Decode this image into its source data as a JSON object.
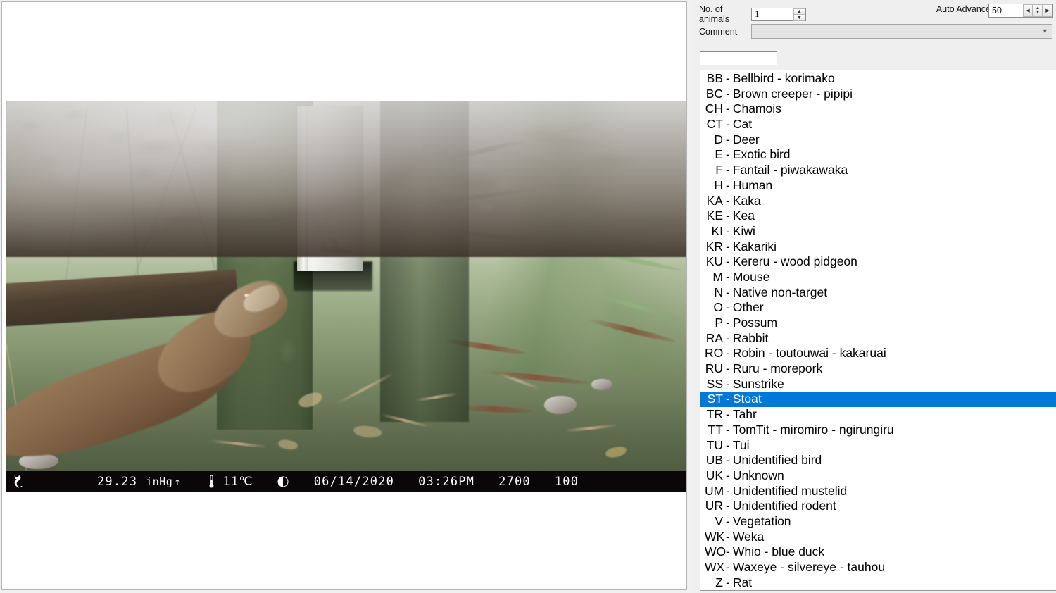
{
  "viewer": {
    "photo": {
      "alt_description": "camera-trap photo of a stoat beside a white metal trap box on a mossy tree trunk in New Zealand bush",
      "infobar": {
        "logo_icon": "browning-buck-logo-icon",
        "pressure": "29.23",
        "pressure_unit": "inHg",
        "pressure_trend": "↑",
        "thermometer_icon": "thermometer-icon",
        "temperature": "11℃",
        "moon_icon": "moon-phase-icon",
        "date": "06/14/2020",
        "time": "03:26PM",
        "camera_id": "2700",
        "battery": "100"
      }
    }
  },
  "classify": {
    "animals": {
      "label": "No. of animals",
      "value": "1",
      "placeholder": "",
      "up_icon": "spinner-up-icon",
      "down_icon": "spinner-down-icon"
    },
    "comment": {
      "label": "Comment",
      "value": "",
      "placeholder": "",
      "chevron_icon": "chevron-down-icon"
    },
    "auto_advance": {
      "label": "Auto Advance",
      "checked": true,
      "check_glyph": "✓",
      "delay_value": "50",
      "prev_icon": "spinner-left-icon",
      "up_icon": "spinner-up-icon",
      "down_icon": "spinner-down-icon",
      "next_icon": "spinner-right-icon"
    },
    "filter": {
      "value": "",
      "placeholder": ""
    },
    "species": {
      "selected_code": "ST",
      "selection_color": "#0078d7",
      "items": [
        {
          "code": "BB",
          "name": "Bellbird - korimako"
        },
        {
          "code": "BC",
          "name": "Brown creeper - pipipi"
        },
        {
          "code": "CH",
          "name": "Chamois"
        },
        {
          "code": "CT",
          "name": "Cat"
        },
        {
          "code": "D",
          "name": "Deer"
        },
        {
          "code": "E",
          "name": "Exotic bird"
        },
        {
          "code": "F",
          "name": "Fantail - piwakawaka"
        },
        {
          "code": "H",
          "name": "Human"
        },
        {
          "code": "KA",
          "name": "Kaka"
        },
        {
          "code": "KE",
          "name": "Kea"
        },
        {
          "code": "KI",
          "name": "Kiwi"
        },
        {
          "code": "KR",
          "name": "Kakariki"
        },
        {
          "code": "KU",
          "name": "Kereru - wood pidgeon"
        },
        {
          "code": "M",
          "name": "Mouse"
        },
        {
          "code": "N",
          "name": "Native non-target"
        },
        {
          "code": "O",
          "name": "Other"
        },
        {
          "code": "P",
          "name": "Possum"
        },
        {
          "code": "RA",
          "name": "Rabbit"
        },
        {
          "code": "RO",
          "name": "Robin - toutouwai - kakaruai"
        },
        {
          "code": "RU",
          "name": "Ruru - morepork"
        },
        {
          "code": "SS",
          "name": "Sunstrike"
        },
        {
          "code": "ST",
          "name": "Stoat"
        },
        {
          "code": "TR",
          "name": "Tahr"
        },
        {
          "code": "TT",
          "name": "TomTit - miromiro - ngirungiru"
        },
        {
          "code": "TU",
          "name": "Tui"
        },
        {
          "code": "UB",
          "name": "Unidentified bird"
        },
        {
          "code": "UK",
          "name": "Unknown"
        },
        {
          "code": "UM",
          "name": "Unidentified mustelid"
        },
        {
          "code": "UR",
          "name": "Unidentified rodent"
        },
        {
          "code": "V",
          "name": "Vegetation"
        },
        {
          "code": "WK",
          "name": "Weka"
        },
        {
          "code": "WO",
          "name": "Whio - blue duck"
        },
        {
          "code": "WX",
          "name": "Waxeye - silvereye - tauhou"
        },
        {
          "code": "Z",
          "name": "Rat"
        }
      ]
    }
  }
}
